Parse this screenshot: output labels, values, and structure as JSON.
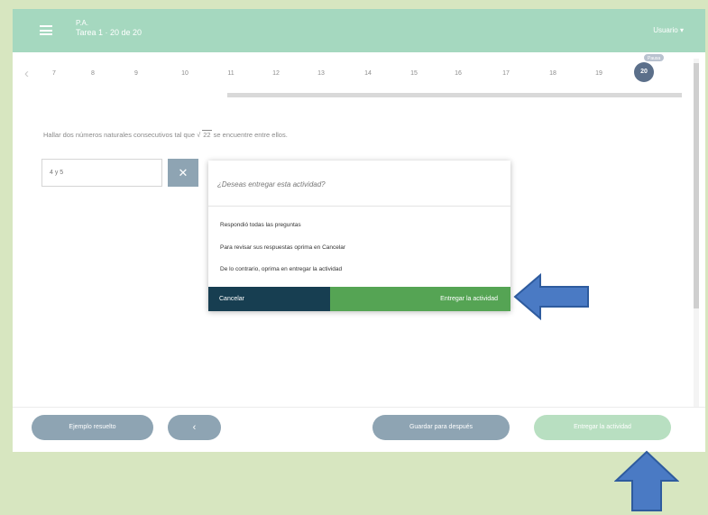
{
  "header": {
    "title": "P.A.",
    "subtitle": "Tarea 1 · 20 de 20",
    "user_menu": "Usuario ▾"
  },
  "question_nav": {
    "prev_symbol": "‹",
    "numbers": [
      "7",
      "8",
      "9",
      "10",
      "11",
      "12",
      "13",
      "14",
      "15",
      "16",
      "17",
      "18",
      "19"
    ],
    "current": "20",
    "current_badge": "Pausa"
  },
  "question": {
    "text_before": "Hallar dos números naturales consecutivos tal que ",
    "radical_symbol": "√",
    "radicand": "22",
    "text_after": " se encuentre entre ellos."
  },
  "answer": {
    "placeholder": "4 y 5",
    "clear_symbol": "✕"
  },
  "dialog": {
    "title": "¿Deseas entregar esta actividad?",
    "lines": [
      "Respondió todas las preguntas",
      "Para revisar sus respuestas oprima en Cancelar",
      "De lo contrario, oprima en entregar la actividad"
    ],
    "cancel_label": "Cancelar",
    "deliver_label": "Entregar la actividad"
  },
  "footer": {
    "example_label": "Ejemplo resuelto",
    "back_label": "‹",
    "later_label": "Guardar para después",
    "deliver_label": "Entregar la actividad"
  },
  "colors": {
    "page_background": "#d7e6c0",
    "header": "#a5d8bf",
    "dialog_cancel": "#173e51",
    "dialog_deliver": "#55a454",
    "annotation_arrow": "#4a7ac4"
  }
}
